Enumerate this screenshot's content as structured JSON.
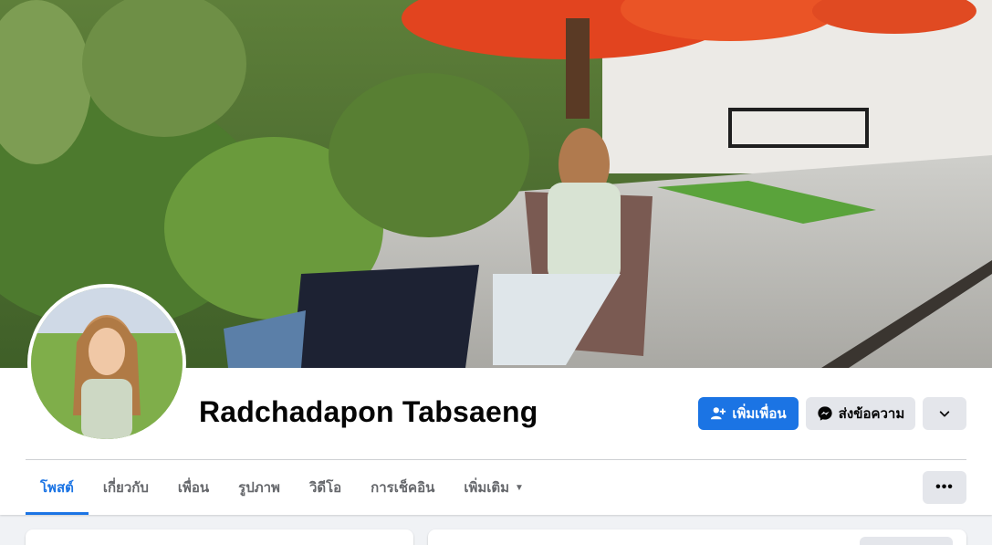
{
  "profile": {
    "name": "Radchadapon Tabsaeng"
  },
  "actions": {
    "add_friend_label": "เพิ่มเพื่อน",
    "add_friend_icon": "add-friend-icon",
    "message_label": "ส่งข้อความ",
    "message_icon": "messenger-icon",
    "more_icon": "chevron-down-icon"
  },
  "tabs": [
    {
      "label": "โพสต์",
      "active": true
    },
    {
      "label": "เกี่ยวกับ",
      "active": false
    },
    {
      "label": "เพื่อน",
      "active": false
    },
    {
      "label": "รูปภาพ",
      "active": false
    },
    {
      "label": "วิดีโอ",
      "active": false
    },
    {
      "label": "การเช็คอิน",
      "active": false
    },
    {
      "label": "เพิ่มเติม",
      "active": false
    }
  ],
  "tabs_more_caret_icon": "caret-down-icon",
  "tabs_overflow_icon": "ellipsis-icon",
  "colors": {
    "primary": "#1b74e4",
    "secondary_bg": "#e4e6eb",
    "page_bg": "#f0f2f5"
  }
}
